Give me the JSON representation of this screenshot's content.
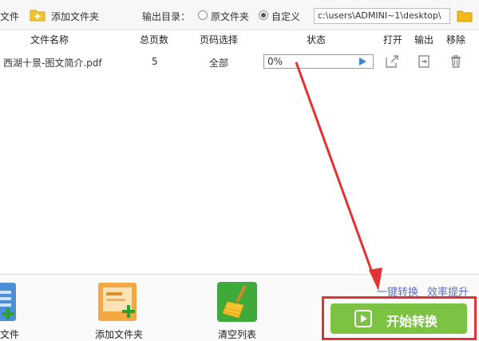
{
  "toolbar": {
    "add_file_label": "文件",
    "add_folder_label": "添加文件夹",
    "output_dir_label": "输出目录：",
    "option_original": "原文件夹",
    "option_custom": "自定义",
    "output_path": "c:\\users\\ADMINI~1\\desktop\\"
  },
  "table": {
    "headers": {
      "name": "文件名称",
      "pages": "总页数",
      "page_select": "页码选择",
      "status": "状态",
      "open": "打开",
      "output": "输出",
      "remove": "移除"
    },
    "rows": [
      {
        "name": "西湖十景-图文简介.pdf",
        "pages": "5",
        "page_select": "全部",
        "progress_text": "0%",
        "progress": 0
      }
    ]
  },
  "bottom": {
    "add_file_label": "文件",
    "add_folder_label": "添加文件夹",
    "clear_list_label": "清空列表",
    "hint_one_click": "一键转换",
    "hint_efficiency": "效率提升",
    "start_label": "开始转换"
  },
  "colors": {
    "start_button": "#7cc243",
    "highlight_frame": "#e23232",
    "progress_arrow": "#3a86d4",
    "hint_text": "#5a6fc8"
  },
  "icons": {
    "add_folder": "folder-plus-icon",
    "browse": "folder-icon",
    "open": "open-external-icon",
    "output": "output-icon",
    "remove": "trash-icon",
    "clear": "broom-icon",
    "start": "play-icon"
  }
}
